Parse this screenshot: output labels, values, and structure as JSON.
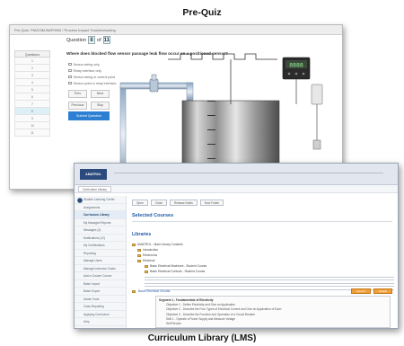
{
  "captions": {
    "top": "Pre-Quiz",
    "bottom": "Curriculum Library (LMS)"
  },
  "prequiz": {
    "window_title": "Pre-Quiz: PM223M-BAP0000 / Process Impact Troubleshooting",
    "question_label": "Question",
    "question_number": "8",
    "question_of": "of",
    "question_total": "11",
    "question_text": "Where does blocked flow sensor passage leak flow occur on a positioned sensor?",
    "sidebar_header": "Questions",
    "sidebar_items": [
      "1",
      "2",
      "3",
      "4",
      "5",
      "6",
      "7",
      "8",
      "9",
      "10",
      "11"
    ],
    "active_index": 7,
    "choices": [
      "Sensor wiring only",
      "Relay interface only",
      "Sensor wiring or control point",
      "Sensor point or relay interface"
    ],
    "buttons": {
      "prev": "Prev",
      "next": "Next",
      "previous": "Previous",
      "skip": "Skip",
      "submit": "Submit Question"
    },
    "meter_reading": "8888"
  },
  "lms": {
    "logo": "AMATROL",
    "tab": "Curriculum Library",
    "toolbar": [
      "Open",
      "Close",
      "Release Notes",
      "New Folder"
    ],
    "heading": "Selected Courses",
    "subhead": "Libraries",
    "sidebar_items": [
      "Student Learning Center",
      "Assignments",
      "Curriculum Library",
      "My Managed Reports",
      "Messages (3)",
      "Notifications (12)",
      "My Certifications",
      "Reporting",
      "Manage Users",
      "Manage Instructor Codes",
      "Add a Custom Course",
      "Batch Import",
      "Batch Export",
      "Admin Tools",
      "Class Reporting",
      "Applying Curriculum",
      "Help"
    ],
    "selected_sidebar": 2,
    "tree": [
      "AMATROL - Main Library Contents",
      "Introduction",
      "Electronics",
      "Electrical",
      "Basic Electrical Machines - Student Course",
      "Basic Electrical Controls - Student Course"
    ],
    "lesson_title": "Basic Electrical Circuits",
    "lesson_buttons": [
      "Launch",
      "Details"
    ],
    "objectives": [
      "Segment 1 - Fundamentals of Electricity",
      "Objective 1 - Define Electricity and Give an Application",
      "Objective 2 - Describe the Four Types of Electrical Current and Give an Application of Each",
      "Objective 3 - Describe the Function and Operation of a Circuit Breaker",
      "Skill 1 - Operate a Power Supply and Measure Voltage",
      "Self Review"
    ]
  }
}
